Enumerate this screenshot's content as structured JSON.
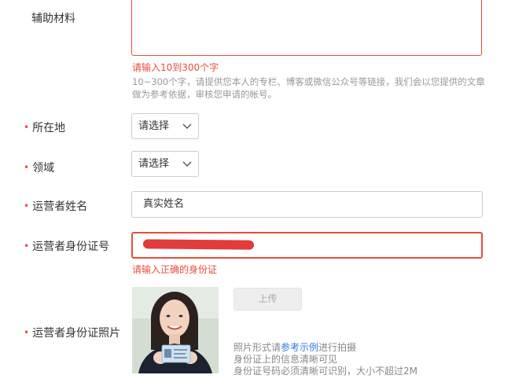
{
  "fields": {
    "aux": {
      "label": "辅助材料",
      "error": "请输入10到300个字",
      "help": "10~300个字，请提供您本人的专栏、博客或微信公众号等链接，我们会以您提供的文章做为参考依据，审核您申请的帐号。"
    },
    "location": {
      "label": "所在地",
      "select_value": "请选择"
    },
    "domain": {
      "label": "领域",
      "select_value": "请选择"
    },
    "operator_name": {
      "label": "运营者姓名",
      "value": "真实姓名"
    },
    "operator_id": {
      "label": "运营者身份证号",
      "error": "请输入正确的身份证"
    },
    "id_photo": {
      "label": "运营者身份证照片",
      "upload_label": "上传",
      "tip_prefix": "照片形式请",
      "tip_link": "参考示例",
      "tip_suffix": "进行拍摄",
      "tip2": "身份证上的信息清晰可见",
      "tip3": "身份证号码必须清晰可识别，大小不超过2M"
    }
  },
  "required_mark": "•",
  "colors": {
    "error": "#e84c3d",
    "link": "#2d7ce0",
    "border": "#cccccc",
    "redaction": "#e23b3b"
  }
}
